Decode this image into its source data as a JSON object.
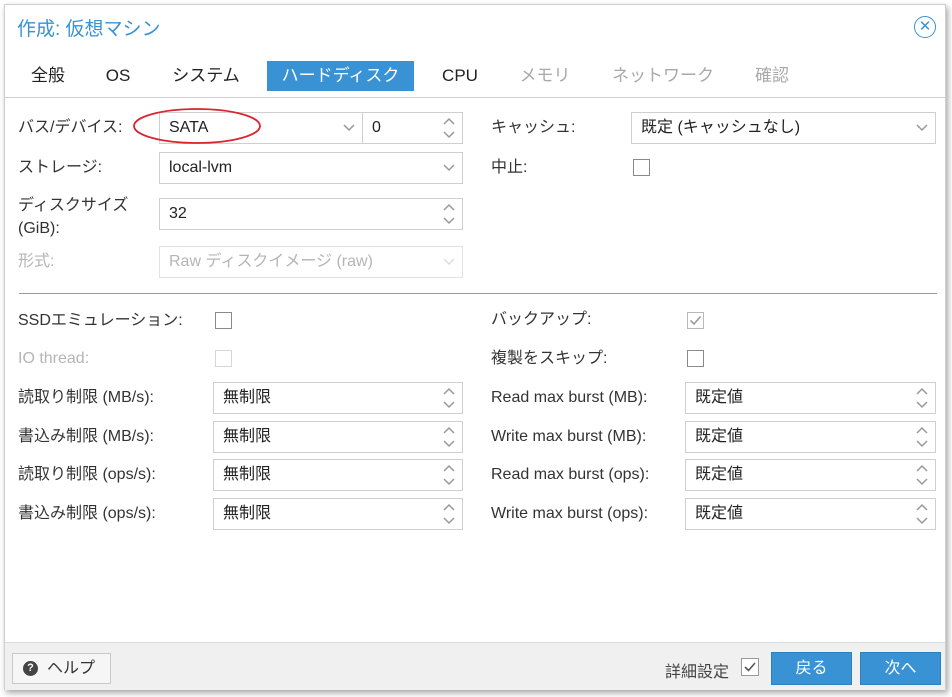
{
  "dialog": {
    "title": "作成: 仮想マシン"
  },
  "tabs": [
    {
      "label": "全般",
      "state": "normal"
    },
    {
      "label": "OS",
      "state": "normal"
    },
    {
      "label": "システム",
      "state": "normal"
    },
    {
      "label": "ハードディスク",
      "state": "active"
    },
    {
      "label": "CPU",
      "state": "normal"
    },
    {
      "label": "メモリ",
      "state": "disabled"
    },
    {
      "label": "ネットワーク",
      "state": "disabled"
    },
    {
      "label": "確認",
      "state": "disabled"
    }
  ],
  "left": {
    "bus_device": {
      "label": "バス/デバイス:",
      "bus": "SATA",
      "device": "0"
    },
    "storage": {
      "label": "ストレージ:",
      "value": "local-lvm"
    },
    "disk_size": {
      "label_line1": "ディスクサイズ",
      "label_line2": "(GiB):",
      "value": "32"
    },
    "format": {
      "label": "形式:",
      "value": "Raw ディスクイメージ (raw)"
    }
  },
  "right": {
    "cache": {
      "label": "キャッシュ:",
      "value": "既定 (キャッシュなし)"
    },
    "discard": {
      "label": "中止:",
      "checked": false
    }
  },
  "advanced_left": {
    "ssd": {
      "label": "SSDエミュレーション:",
      "checked": false
    },
    "iothread": {
      "label": "IO thread:",
      "checked": false
    },
    "read_mbs": {
      "label": "読取り制限 (MB/s):",
      "value": "無制限"
    },
    "write_mbs": {
      "label": "書込み制限 (MB/s):",
      "value": "無制限"
    },
    "read_ops": {
      "label": "読取り制限 (ops/s):",
      "value": "無制限"
    },
    "write_ops": {
      "label": "書込み制限 (ops/s):",
      "value": "無制限"
    }
  },
  "advanced_right": {
    "backup": {
      "label": "バックアップ:",
      "checked": true
    },
    "skip_replication": {
      "label": "複製をスキップ:",
      "checked": false
    },
    "read_burst_mb": {
      "label": "Read max burst (MB):",
      "value": "既定値"
    },
    "write_burst_mb": {
      "label": "Write max burst (MB):",
      "value": "既定値"
    },
    "read_burst_ops": {
      "label": "Read max burst (ops):",
      "value": "既定値"
    },
    "write_burst_ops": {
      "label": "Write max burst (ops):",
      "value": "既定値"
    }
  },
  "footer": {
    "help_label": "ヘルプ",
    "advanced_label": "詳細設定",
    "advanced_checked": true,
    "back_label": "戻る",
    "next_label": "次へ"
  },
  "colors": {
    "accent": "#3892d4",
    "annotation": "#d9262e"
  },
  "icons": [
    "close-icon",
    "help-icon",
    "chevron-down-icon",
    "spinner-icon",
    "check-icon"
  ]
}
